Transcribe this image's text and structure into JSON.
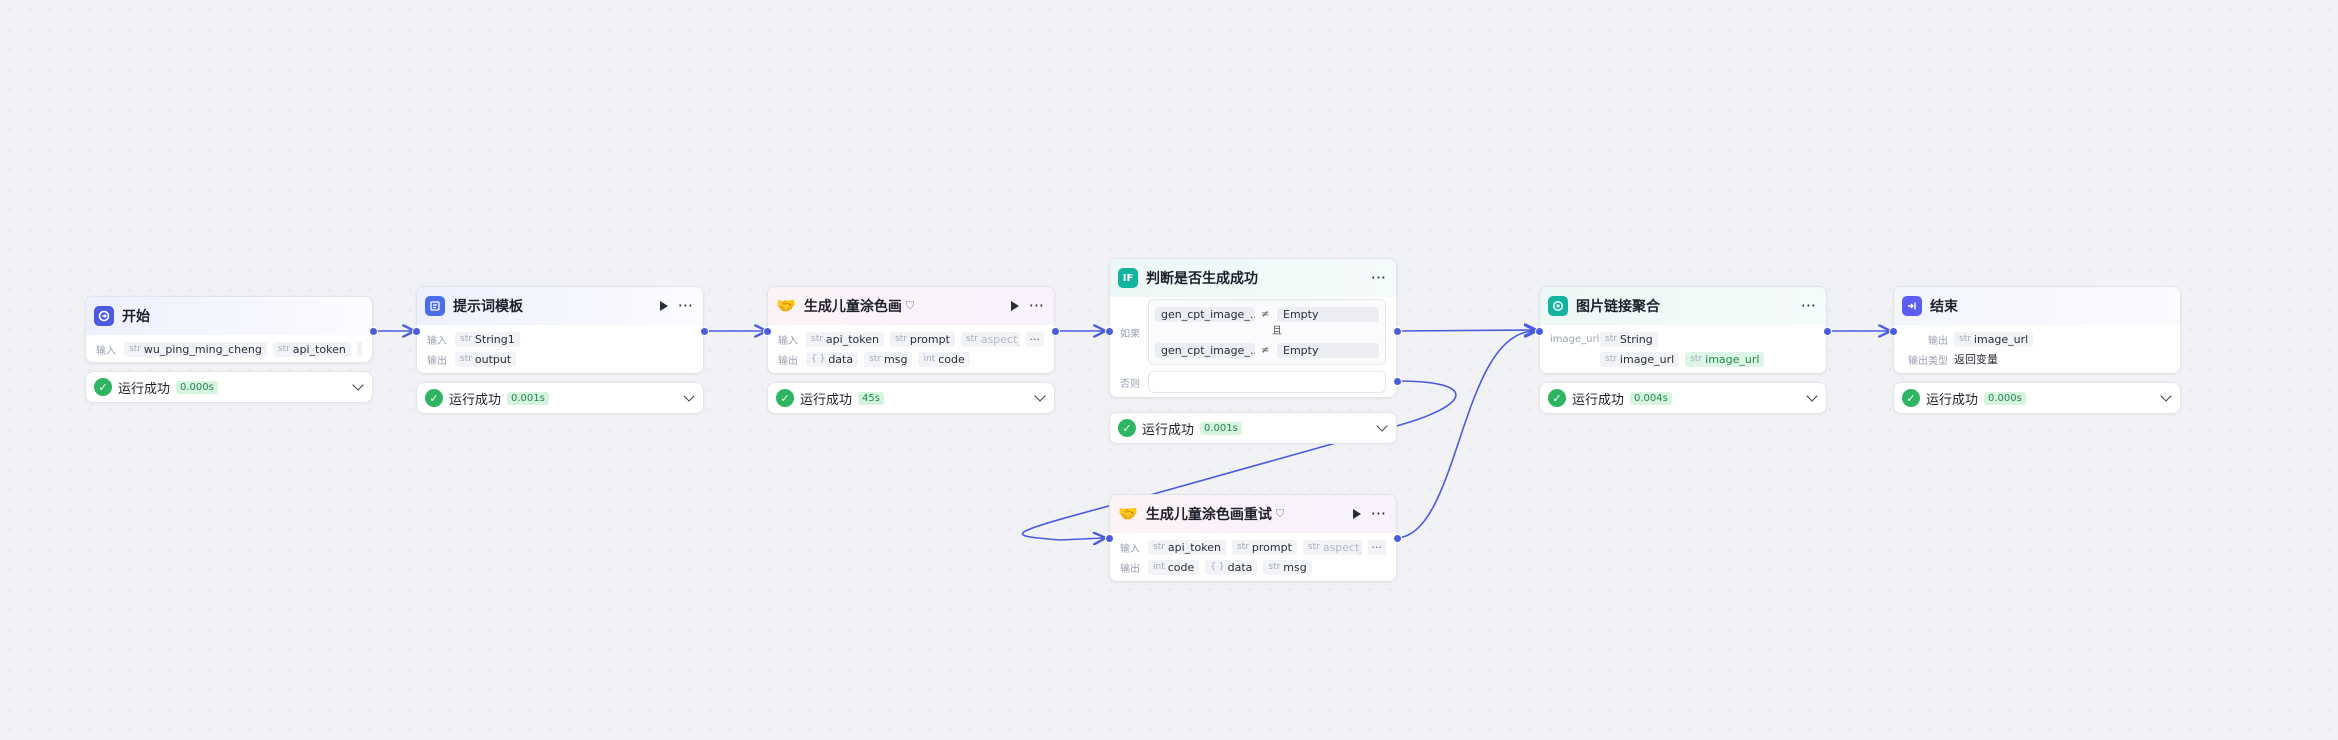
{
  "nodes": {
    "start": {
      "title": "开始",
      "input_label": "输入",
      "inputs": [
        {
          "type": "str",
          "name": "wu_ping_ming_cheng"
        },
        {
          "type": "str",
          "name": "api_token"
        }
      ],
      "status": "运行成功",
      "time": "0.000s"
    },
    "prompt_template": {
      "title": "提示词模板",
      "input_label": "输入",
      "output_label": "输出",
      "inputs": [
        {
          "type": "str",
          "name": "String1"
        }
      ],
      "outputs": [
        {
          "type": "str",
          "name": "output"
        }
      ],
      "status": "运行成功",
      "time": "0.001s"
    },
    "gen_coloring": {
      "title": "生成儿童涂色画",
      "input_label": "输入",
      "output_label": "输出",
      "inputs": [
        {
          "type": "str",
          "name": "api_token"
        },
        {
          "type": "str",
          "name": "prompt"
        },
        {
          "type": "str",
          "name": "aspect_ratio"
        }
      ],
      "outputs": [
        {
          "type": "{ }",
          "name": "data"
        },
        {
          "type": "str",
          "name": "msg"
        },
        {
          "type": "int",
          "name": "code"
        }
      ],
      "status": "运行成功",
      "time": "45s"
    },
    "condition": {
      "icon": "IF",
      "title": "判断是否生成成功",
      "if_label": "如果",
      "else_label": "否则",
      "conditions": [
        {
          "var": "gen_cpt_image_...",
          "op": "≠",
          "value": "Empty"
        },
        {
          "var": "gen_cpt_image_...",
          "op": "≠",
          "value": "Empty"
        }
      ],
      "and_label": "且",
      "status": "运行成功",
      "time": "0.001s"
    },
    "gen_retry": {
      "title": "生成儿童涂色画重试",
      "input_label": "输入",
      "output_label": "输出",
      "inputs": [
        {
          "type": "str",
          "name": "api_token"
        },
        {
          "type": "str",
          "name": "prompt"
        },
        {
          "type": "str",
          "name": "aspect_ratio"
        }
      ],
      "outputs": [
        {
          "type": "int",
          "name": "code"
        },
        {
          "type": "{ }",
          "name": "data"
        },
        {
          "type": "str",
          "name": "msg"
        }
      ]
    },
    "image_agg": {
      "title": "图片链接聚合",
      "param_label": "image_url",
      "inputs": [
        {
          "type": "str",
          "name": "String"
        }
      ],
      "outputs": [
        {
          "type": "str",
          "name": "image_url"
        },
        {
          "type": "str",
          "name": "image_url"
        }
      ],
      "status": "运行成功",
      "time": "0.004s"
    },
    "end": {
      "title": "结束",
      "output_label": "输出",
      "output_type_label": "输出类型",
      "outputs": [
        {
          "type": "str",
          "name": "image_url"
        }
      ],
      "output_type": "返回变量",
      "status": "运行成功",
      "time": "0.000s"
    }
  },
  "colors": {
    "edge": "#4a5be0",
    "success": "#2fb462",
    "start_icon": "#4a5be0",
    "template_icon": "#4a6ee8",
    "if_icon": "#12b3a0",
    "agg_icon": "#12b3a0",
    "end_icon": "#5b5ef0"
  },
  "icons": {
    "start": "start-icon",
    "template": "template-icon",
    "plugin": "handshake-icon",
    "if": "if-icon",
    "aggregate": "aggregate-icon",
    "end": "end-icon",
    "status": "check-circle-icon"
  }
}
